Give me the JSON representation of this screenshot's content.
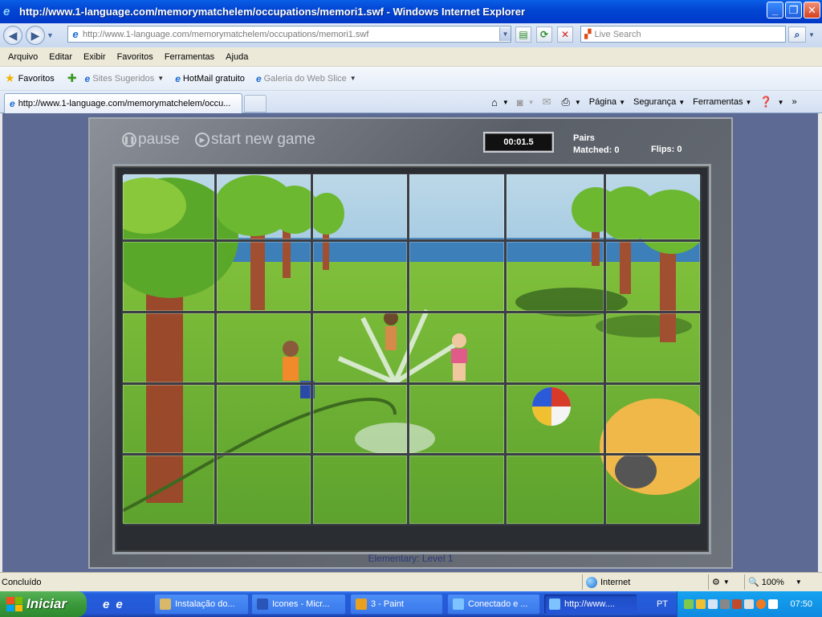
{
  "window": {
    "title": "http://www.1-language.com/memorymatchelem/occupations/memori1.swf - Windows Internet Explorer",
    "minimize_glyph": "_",
    "restore_glyph": "❐",
    "close_glyph": "✕"
  },
  "address_bar": {
    "url_host": "http://www.1-language.com",
    "url_path": "/memorymatchelem/occupations/memori1.swf",
    "search_placeholder": "Live Search"
  },
  "menu": {
    "items": [
      "Arquivo",
      "Editar",
      "Exibir",
      "Favoritos",
      "Ferramentas",
      "Ajuda"
    ]
  },
  "favorites_bar": {
    "favorites_label": "Favoritos",
    "items": [
      {
        "label": "Sites Sugeridos",
        "dim": true,
        "dropdown": true
      },
      {
        "label": "HotMail gratuito",
        "dim": false,
        "dropdown": false
      },
      {
        "label": "Galeria do Web Slice",
        "dim": true,
        "dropdown": true
      }
    ]
  },
  "tabs": {
    "active_tab_label": "http://www.1-language.com/memorymatchelem/occu..."
  },
  "command_bar": {
    "page_label": "Página",
    "security_label": "Segurança",
    "tools_label": "Ferramentas"
  },
  "game": {
    "pause_label": "pause",
    "new_game_label": "start new game",
    "timer": "00:01.5",
    "pairs_label": "Pairs",
    "matched_label": "Matched: 0",
    "flips_label": "Flips: 0",
    "level_label": "Elementary: Level 1",
    "grid_rows": 5,
    "grid_cols": 6
  },
  "status_bar": {
    "status_text": "Concluído",
    "zone_text": "Internet",
    "zoom_text": "100%"
  },
  "taskbar": {
    "start_label": "Iniciar",
    "tasks": [
      {
        "label": "Instalação do...",
        "icon_color": "#d9b86a",
        "active": false
      },
      {
        "label": "Icones - Micr...",
        "icon_color": "#2a55b8",
        "active": false
      },
      {
        "label": "3 - Paint",
        "icon_color": "#e8a020",
        "active": false
      },
      {
        "label": "Conectado e ...",
        "icon_color": "#7ec3ff",
        "active": false
      },
      {
        "label": "http://www....",
        "icon_color": "#7ec3ff",
        "active": true
      }
    ],
    "language": "PT",
    "clock": "07:50"
  }
}
